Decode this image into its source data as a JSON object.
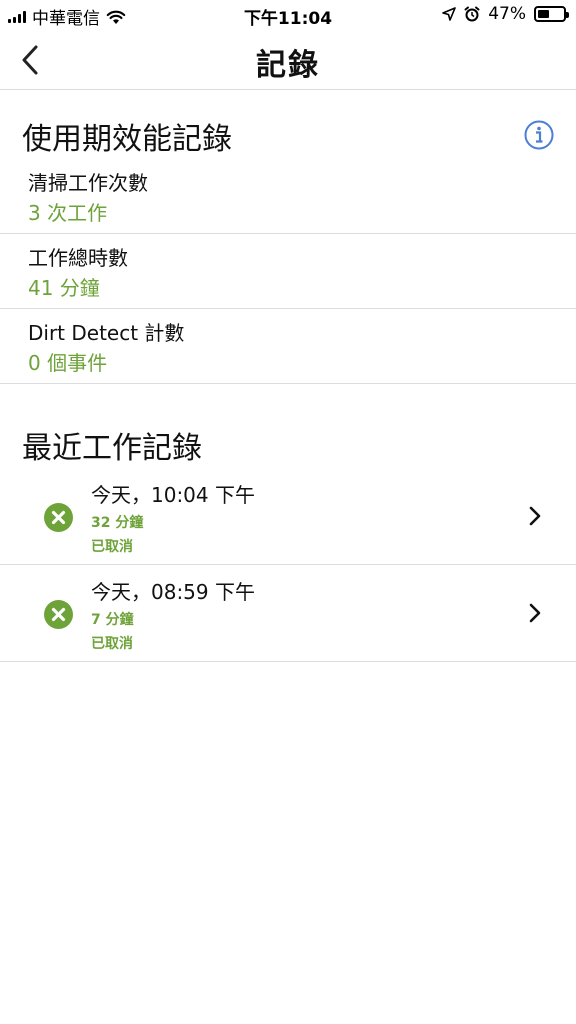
{
  "status_bar": {
    "carrier": "中華電信",
    "time": "下午11:04",
    "battery": "47%",
    "battery_level": 0.47
  },
  "nav": {
    "title": "記錄"
  },
  "lifetime": {
    "title": "使用期效能記錄",
    "stats": [
      {
        "label": "清掃工作次數",
        "value": "3 次工作"
      },
      {
        "label": "工作總時數",
        "value": "41 分鐘"
      },
      {
        "label": "Dirt Detect 計數",
        "value": "0 個事件"
      }
    ]
  },
  "recent": {
    "title": "最近工作記錄",
    "jobs": [
      {
        "time": "今天，10:04 下午",
        "duration": "32 分鐘",
        "status": "已取消"
      },
      {
        "time": "今天，08:59 下午",
        "duration": "7 分鐘",
        "status": "已取消"
      }
    ]
  },
  "colors": {
    "accent_green": "#6ea33a",
    "info_blue": "#4a7fd4",
    "divider": "#dcdcdc"
  }
}
